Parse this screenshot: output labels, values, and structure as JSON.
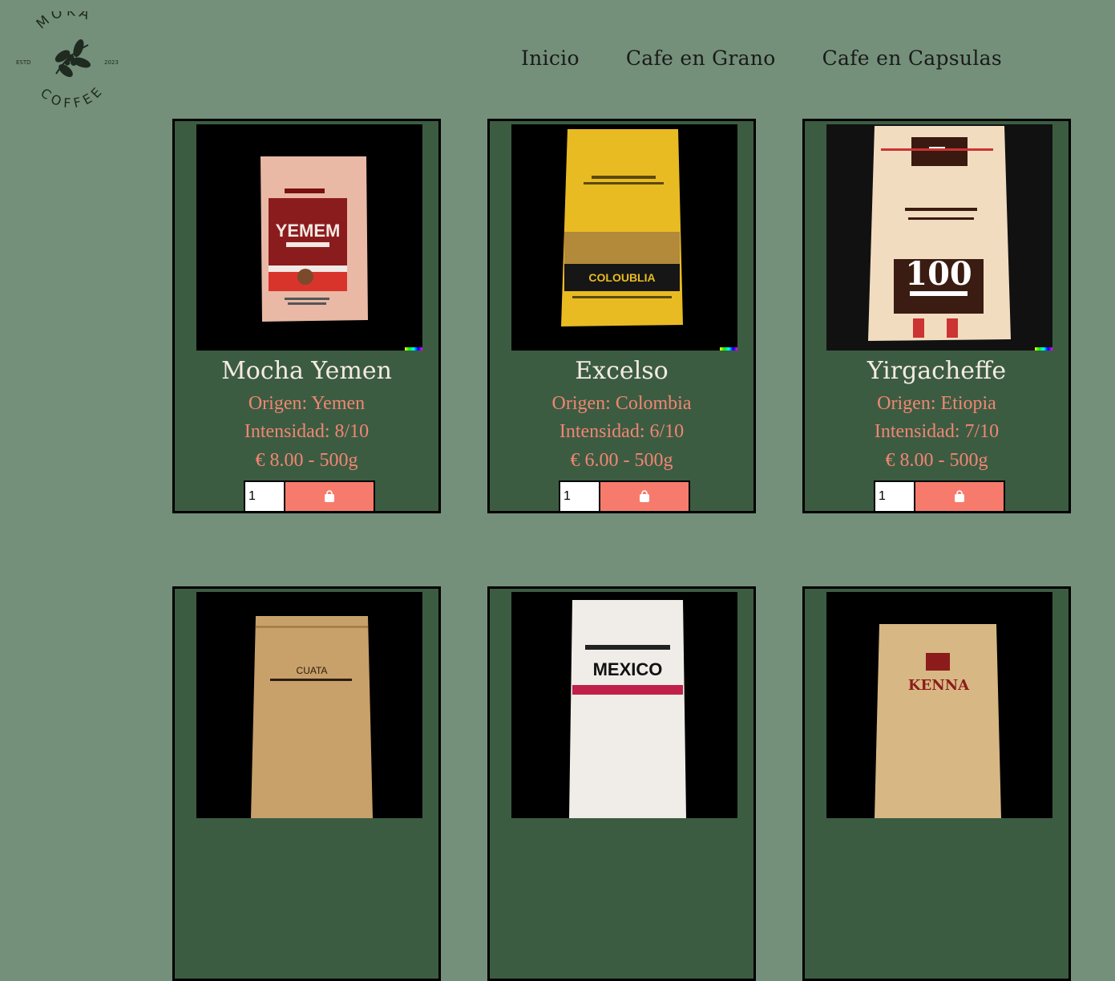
{
  "brand": {
    "top": "MOKA",
    "bottom": "COFFEE",
    "left": "ESTD",
    "right": "2023"
  },
  "nav": [
    {
      "label": "Inicio"
    },
    {
      "label": "Cafe en Grano"
    },
    {
      "label": "Cafe en Capsulas"
    }
  ],
  "products": [
    {
      "name": "Mocha Yemen",
      "origin": "Origen: Yemen",
      "intensity": "Intensidad: 8/10",
      "price": "€ 8.00 - 500g",
      "qty": "1",
      "bag_text": "YEMEM"
    },
    {
      "name": "Excelso",
      "origin": "Origen: Colombia",
      "intensity": "Intensidad: 6/10",
      "price": "€ 6.00 - 500g",
      "qty": "1",
      "bag_text": "COLOUBLIA"
    },
    {
      "name": "Yirgacheffe",
      "origin": "Origen: Etiopia",
      "intensity": "Intensidad: 7/10",
      "price": "€ 8.00 - 500g",
      "qty": "1",
      "bag_text": "100"
    },
    {
      "bag_text": "CUATA"
    },
    {
      "bag_text": "MEXICO"
    },
    {
      "bag_text": "KENNA"
    }
  ],
  "icons": {
    "cart": "shopping-bag-icon"
  },
  "colors": {
    "background": "#74907a",
    "card": "#3c5c42",
    "accent": "#f77b6c",
    "title": "#f4ebe1",
    "info": "#f08672"
  }
}
